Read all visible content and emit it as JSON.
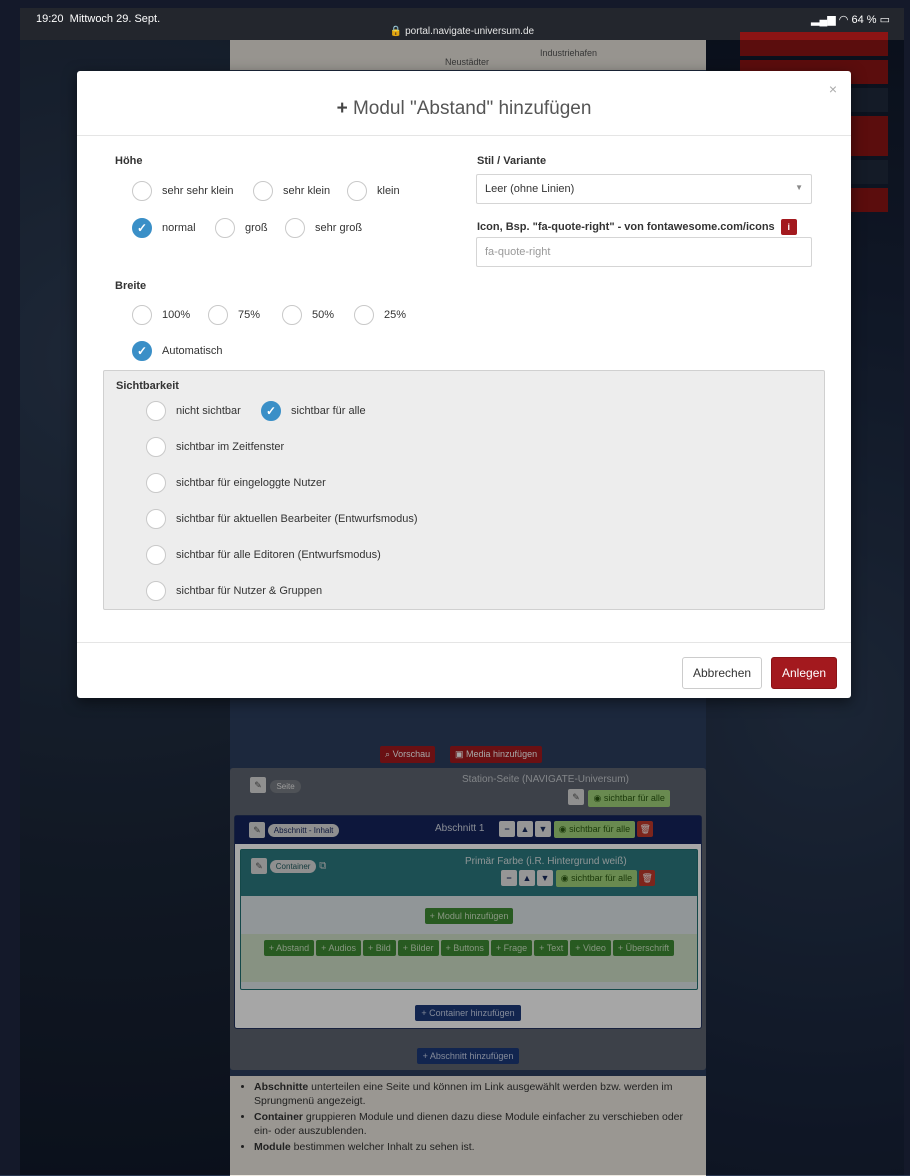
{
  "status": {
    "time": "19:20",
    "date": "Mittwoch 29. Sept.",
    "url": "portal.navigate-universum.de",
    "battery": "64 %"
  },
  "behind": {
    "map_label1": "Industriehafen",
    "map_label2": "Neustädter"
  },
  "modal": {
    "title": "Modul \"Abstand\" hinzufügen",
    "close_label": "×",
    "hoehe": {
      "label": "Höhe",
      "options": [
        "sehr sehr klein",
        "sehr klein",
        "klein",
        "normal",
        "groß",
        "sehr groß"
      ],
      "selected": "normal"
    },
    "stil": {
      "label": "Stil / Variante",
      "value": "Leer (ohne Linien)"
    },
    "icon": {
      "label": "Icon, Bsp. \"fa-quote-right\" - von fontawesome.com/icons",
      "placeholder": "fa-quote-right",
      "info": "i"
    },
    "breite": {
      "label": "Breite",
      "options": [
        "100%",
        "75%",
        "50%",
        "25%",
        "Automatisch"
      ],
      "selected": "Automatisch"
    },
    "sichtbarkeit": {
      "label": "Sichtbarkeit",
      "options": [
        "nicht sichtbar",
        "sichtbar für alle",
        "sichtbar im Zeitfenster",
        "sichtbar für eingeloggte Nutzer",
        "sichtbar für aktuellen Bearbeiter (Entwurfsmodus)",
        "sichtbar für alle Editoren (Entwurfsmodus)",
        "sichtbar für Nutzer & Gruppen"
      ],
      "selected": "sichtbar für alle"
    },
    "cancel": "Abbrechen",
    "submit": "Anlegen"
  },
  "page": {
    "vorschau": "Vorschau",
    "media": "Media hinzufügen",
    "seite_pill": "Seite",
    "seite_title": "Station-Seite (NAVIGATE-Universum)",
    "visible_all": "sichtbar für alle",
    "abschnitt_pill": "Abschnitt - Inhalt",
    "abschnitt_title": "Abschnitt 1",
    "container_pill": "Container",
    "container_title": "Primär Farbe (i.R. Hintergrund weiß)",
    "modul_add": "Modul hinzufügen",
    "module_buttons": [
      "Abstand",
      "Audios",
      "Bild",
      "Bilder",
      "Buttons",
      "Frage",
      "Text",
      "Video",
      "Überschrift"
    ],
    "container_add": "Container hinzufügen",
    "abschnitt_add": "Abschnitt hinzufügen",
    "help": [
      {
        "bold": "Abschnitte",
        "text": " unterteilen eine Seite und können im Link ausgewählt werden bzw. werden im Sprungmenü angezeigt."
      },
      {
        "bold": "Container",
        "text": " gruppieren Module und dienen dazu diese Module einfacher zu verschieben oder ein- oder auszublenden."
      },
      {
        "bold": "Module",
        "text": " bestimmen welcher Inhalt zu sehen ist."
      }
    ]
  }
}
